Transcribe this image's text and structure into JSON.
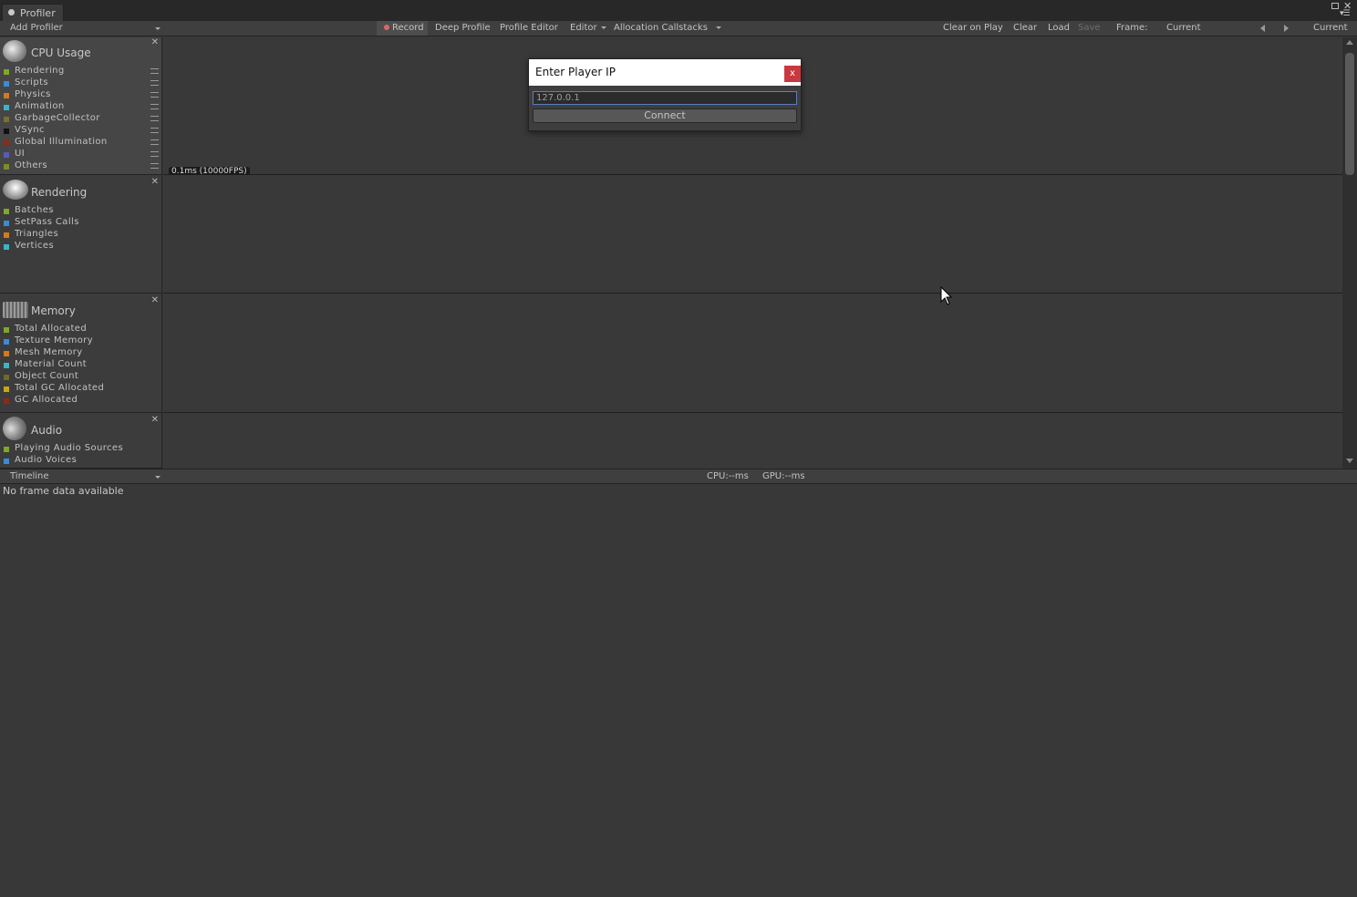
{
  "window": {
    "tab_label": "Profiler"
  },
  "toolbar": {
    "add_profiler": "Add Profiler",
    "record": "Record",
    "deep_profile": "Deep Profile",
    "profile_editor": "Profile Editor",
    "target": "Editor",
    "allocation_callstacks": "Allocation Callstacks",
    "clear_on_play": "Clear on Play",
    "clear": "Clear",
    "load": "Load",
    "save": "Save",
    "frame_label": "Frame:",
    "frame_value": "Current",
    "current": "Current"
  },
  "panels": {
    "cpu": {
      "title": "CPU Usage",
      "items": [
        {
          "label": "Rendering",
          "color": "#7da82b"
        },
        {
          "label": "Scripts",
          "color": "#3e8ad4"
        },
        {
          "label": "Physics",
          "color": "#d07a21"
        },
        {
          "label": "Animation",
          "color": "#3fb3c6"
        },
        {
          "label": "GarbageCollector",
          "color": "#7a6f2e"
        },
        {
          "label": "VSync",
          "color": "#111111"
        },
        {
          "label": "Global Illumination",
          "color": "#8a2b1a"
        },
        {
          "label": "UI",
          "color": "#5c5ab2"
        },
        {
          "label": "Others",
          "color": "#7c8c2a"
        }
      ],
      "fps_label": "0.1ms (10000FPS)"
    },
    "rendering": {
      "title": "Rendering",
      "items": [
        {
          "label": "Batches",
          "color": "#7da82b"
        },
        {
          "label": "SetPass Calls",
          "color": "#3e8ad4"
        },
        {
          "label": "Triangles",
          "color": "#d07a21"
        },
        {
          "label": "Vertices",
          "color": "#3fb3c6"
        }
      ]
    },
    "memory": {
      "title": "Memory",
      "items": [
        {
          "label": "Total Allocated",
          "color": "#7da82b"
        },
        {
          "label": "Texture Memory",
          "color": "#3e8ad4"
        },
        {
          "label": "Mesh Memory",
          "color": "#d07a21"
        },
        {
          "label": "Material Count",
          "color": "#3fb3c6"
        },
        {
          "label": "Object Count",
          "color": "#6d6a2a"
        },
        {
          "label": "Total GC Allocated",
          "color": "#c9a419"
        },
        {
          "label": "GC Allocated",
          "color": "#8a2b1a"
        }
      ]
    },
    "audio": {
      "title": "Audio",
      "items": [
        {
          "label": "Playing Audio Sources",
          "color": "#7da82b"
        },
        {
          "label": "Audio Voices",
          "color": "#3e8ad4"
        }
      ]
    }
  },
  "bottom": {
    "view_mode": "Timeline",
    "cpu_time": "CPU:--ms",
    "gpu_time": "GPU:--ms",
    "no_data": "No frame data available"
  },
  "dialog": {
    "title": "Enter Player IP",
    "close": "x",
    "ip_value": "127.0.0.1",
    "connect": "Connect"
  }
}
